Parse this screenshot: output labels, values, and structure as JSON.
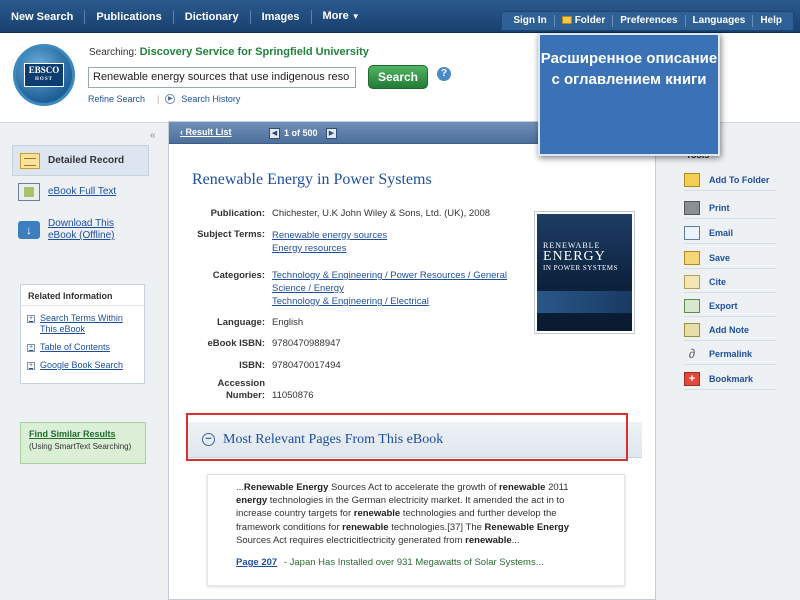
{
  "topnav": {
    "items": [
      "New Search",
      "Publications",
      "Dictionary",
      "Images",
      "More"
    ]
  },
  "rightnav": {
    "items": [
      "Sign In",
      "Folder",
      "Preferences",
      "Languages",
      "Help"
    ]
  },
  "search": {
    "searching_label": "Searching:",
    "database": "Discovery Service for Springfield University",
    "query": "Renewable energy sources that use indigenous reso",
    "button": "Search",
    "help": "?",
    "refine": "Refine Search",
    "history": "Search History"
  },
  "logo": {
    "top": "EBSCO",
    "bottom": "HOST"
  },
  "callout": {
    "text": "Расширенное описание с оглавлением книги"
  },
  "left": {
    "detailed_record": "Detailed Record",
    "ebook_full_text": "eBook Full Text",
    "download_line1": "Download This",
    "download_line2": "eBook (Offline)",
    "related_title": "Related Information",
    "related_links": [
      "Search Terms Within This eBook",
      "Table of Contents",
      "Google Book Search"
    ],
    "similar_link": "Find Similar Results",
    "similar_sub": "(Using SmartText Searching)"
  },
  "pager": {
    "result_list": "Result List",
    "text": "1 of 500"
  },
  "record": {
    "title": "Renewable Energy in Power Systems",
    "labels": {
      "publication": "Publication:",
      "subject": "Subject Terms:",
      "categories": "Categories:",
      "language": "Language:",
      "ebook_isbn": "eBook ISBN:",
      "isbn": "ISBN:",
      "accession1": "Accession",
      "accession2": "Number:"
    },
    "publication": "Chichester, U.K John Wiley & Sons, Ltd. (UK), 2008",
    "subjects": [
      "Renewable energy sources",
      "Energy resources"
    ],
    "categories": [
      "Technology & Engineering / Power Resources / General",
      "Science / Energy",
      "Technology & Engineering / Electrical"
    ],
    "language": "English",
    "ebook_isbn": "9780470988947",
    "isbn": "9780470017494",
    "accession": "11050876"
  },
  "cover": {
    "line1": "RENEWABLE",
    "line2": "ENERGY",
    "line3": "IN POWER SYSTEMS"
  },
  "relevant": {
    "title": "Most Relevant Pages From This eBook",
    "page_link": "Page 207",
    "page_desc": "- Japan Has Installed over 931 Megawatts of Solar Systems..."
  },
  "tools": {
    "label": "Tools",
    "items": [
      "Add To Folder",
      "Print",
      "Email",
      "Save",
      "Cite",
      "Export",
      "Add Note",
      "Permalink",
      "Bookmark"
    ]
  }
}
